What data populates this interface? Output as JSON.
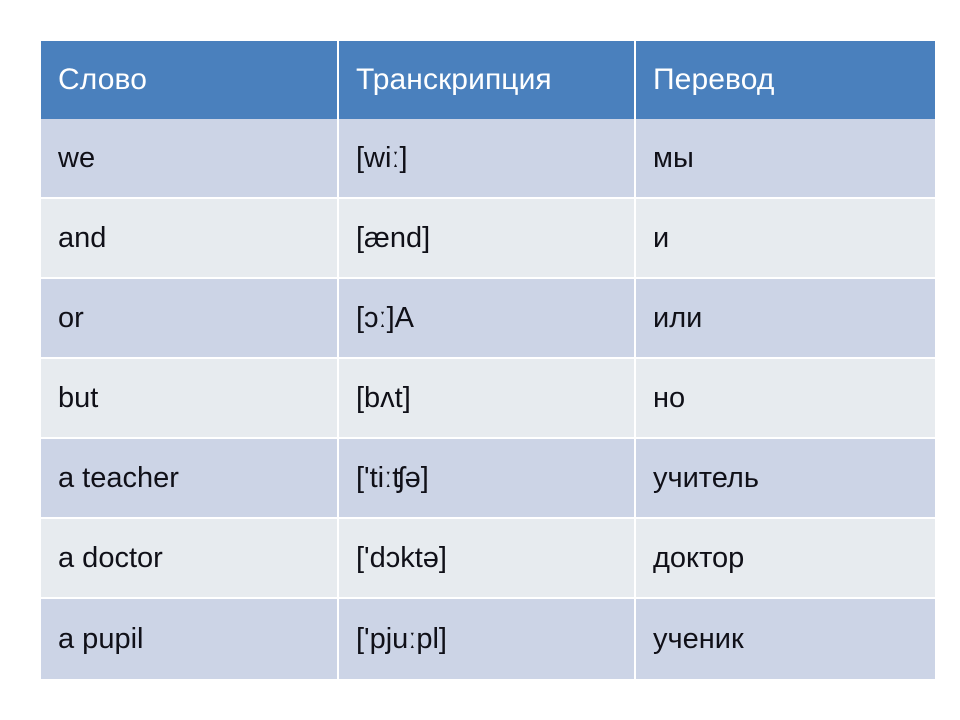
{
  "table": {
    "columns": [
      {
        "id": "word",
        "label": "Слово"
      },
      {
        "id": "translit",
        "label": "Транскрипция"
      },
      {
        "id": "translation",
        "label": "Перевод"
      }
    ],
    "rows": [
      {
        "word": "we",
        "translit": "[wiː]",
        "translation": "мы"
      },
      {
        "word": "and",
        "translit": "[ænd]",
        "translation": "и"
      },
      {
        "word": "or",
        "translit": "[ɔː]A",
        "translation": "или"
      },
      {
        "word": "but",
        "translit": "[bʌt]",
        "translation": "но"
      },
      {
        "word": "a teacher",
        "translit": "['tiːʧə]",
        "translation": "учитель"
      },
      {
        "word": "a doctor",
        "translit": "['dɔktə]",
        "translation": "доктор"
      },
      {
        "word": "a pupil",
        "translit": "['pjuːpl]",
        "translation": "ученик"
      }
    ]
  },
  "colors": {
    "header_background": "#4a80bd",
    "header_text": "#ffffff",
    "row_odd_background": "#ccd4e6",
    "row_even_background": "#e7ebef",
    "body_text": "#101018",
    "gridline": "#ffffff",
    "page_background": "#ffffff"
  }
}
